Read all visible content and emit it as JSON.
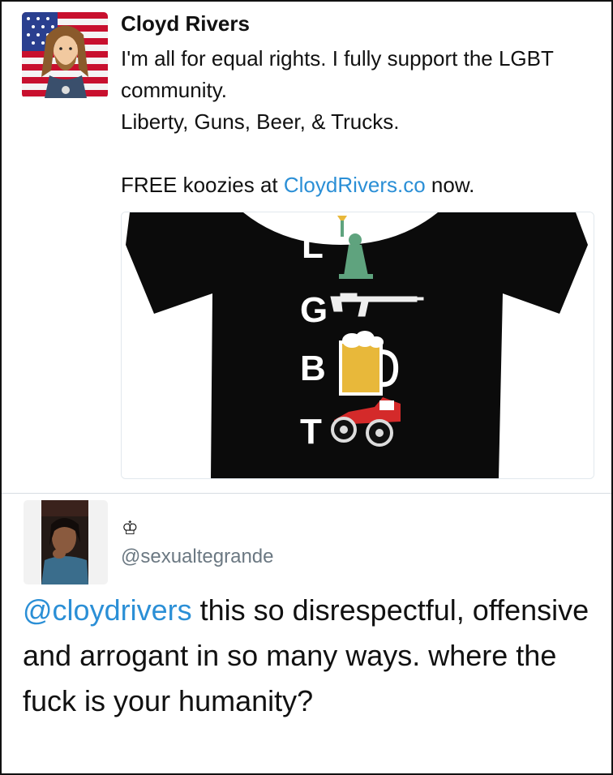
{
  "tweet1": {
    "author_name": "Cloyd Rivers",
    "avatar": "cartoon-portrait-flag-avatar",
    "line1": "I'm all for equal rights. I fully support the LGBT community.",
    "line2": "Liberty, Guns, Beer, & Trucks.",
    "promo_prefix": "FREE koozies at ",
    "promo_link": "CloydRivers.co",
    "promo_suffix": " now.",
    "media": {
      "letters": [
        "L",
        "G",
        "B",
        "T"
      ],
      "icons": [
        "statue-of-liberty-icon",
        "rifle-icon",
        "beer-mug-icon",
        "monster-truck-icon"
      ]
    }
  },
  "tweet2": {
    "crown_glyph": "♔",
    "handle": "@sexualtegrande",
    "mention": "@cloydrivers",
    "body": " this so disrespectful, offensive and arrogant in so many ways. where the fuck is your humanity?"
  },
  "colors": {
    "link": "#2b8fd6",
    "handle": "#6b7882",
    "shirt": "#0b0b0b",
    "truck": "#d42a2a",
    "beer": "#e8b83a"
  }
}
